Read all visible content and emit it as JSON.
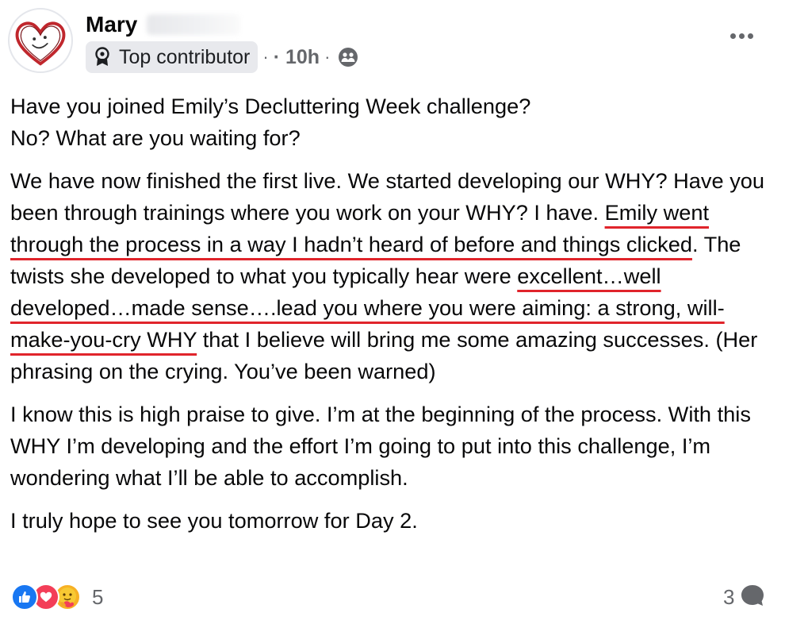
{
  "post": {
    "author_name": "Mary",
    "badge_label": "Top contributor",
    "separator": "·",
    "timestamp": "· 10h",
    "paragraphs": [
      {
        "segments": [
          {
            "text": "Have you joined Emily’s Decluttering Week challenge?"
          },
          {
            "text": "\nNo? What are you waiting for?"
          }
        ]
      },
      {
        "segments": [
          {
            "text": "We have now finished the first live.  We started developing  our WHY? Have you been through trainings where you work on your WHY? I have.  "
          },
          {
            "text": "Emily went through the process in a way I hadn’t heard of before and things clicked",
            "highlighted": true
          },
          {
            "text": ".  The twists she developed to what you typically hear were "
          },
          {
            "text": "excellent…well developed…made sense….lead you where you were aiming: a strong, will-make-you-cry WHY",
            "highlighted": true
          },
          {
            "text": " that I believe will bring me some amazing successes.  (Her phrasing on the crying. You’ve been warned)"
          }
        ]
      },
      {
        "segments": [
          {
            "text": "I know this is high praise to give.  I’m at the beginning of the process. With this WHY I’m developing and the effort I’m going to put into this challenge, I’m wondering what I’ll be able to accomplish."
          }
        ]
      },
      {
        "segments": [
          {
            "text": "I truly hope to see you tomorrow for Day 2."
          }
        ]
      }
    ],
    "reactions": {
      "icons": [
        "like-icon",
        "love-icon",
        "care-icon"
      ],
      "count": "5"
    },
    "comment_count": "3",
    "icons": {
      "avatar": "heart-smiley-avatar",
      "badge": "award-icon",
      "audience": "group-audience-icon",
      "more": "more-options-icon",
      "comment": "comment-bubble-icon"
    },
    "colors": {
      "highlight_underline": "#e0242b",
      "like": "#1877f2",
      "love": "#f33e58",
      "care": "#f7b125",
      "secondary_text": "#65676b"
    }
  }
}
